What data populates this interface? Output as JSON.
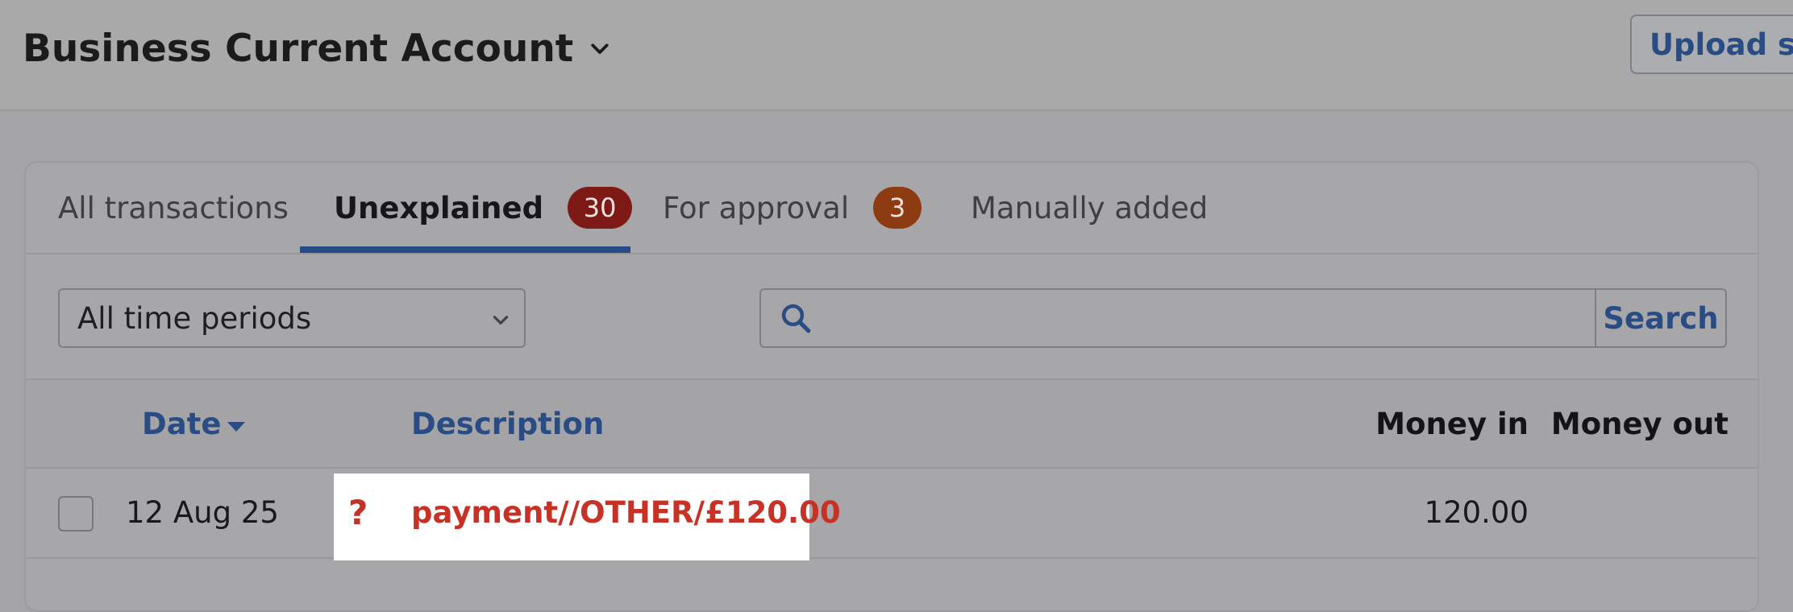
{
  "header": {
    "account_title": "Business Current Account",
    "upload_label": "Upload statement"
  },
  "tabs": [
    {
      "label": "All transactions"
    },
    {
      "label": "Unexplained",
      "badge": "30"
    },
    {
      "label": "For approval",
      "badge": "3"
    },
    {
      "label": "Manually added"
    }
  ],
  "filters": {
    "period_selected": "All time periods",
    "search_value": "",
    "search_button": "Search"
  },
  "table": {
    "columns": {
      "date": "Date",
      "description": "Description",
      "money_in": "Money in",
      "money_out": "Money out"
    },
    "rows": [
      {
        "date": "12 Aug 25",
        "status_symbol": "?",
        "description": "payment//OTHER/£120.00",
        "money_in": "120.00",
        "money_out": ""
      }
    ]
  },
  "colors": {
    "accent_blue": "#284c83",
    "unexplained_red": "#c73126",
    "badge_red": "#7e1a16",
    "badge_orange": "#8c3c10"
  }
}
